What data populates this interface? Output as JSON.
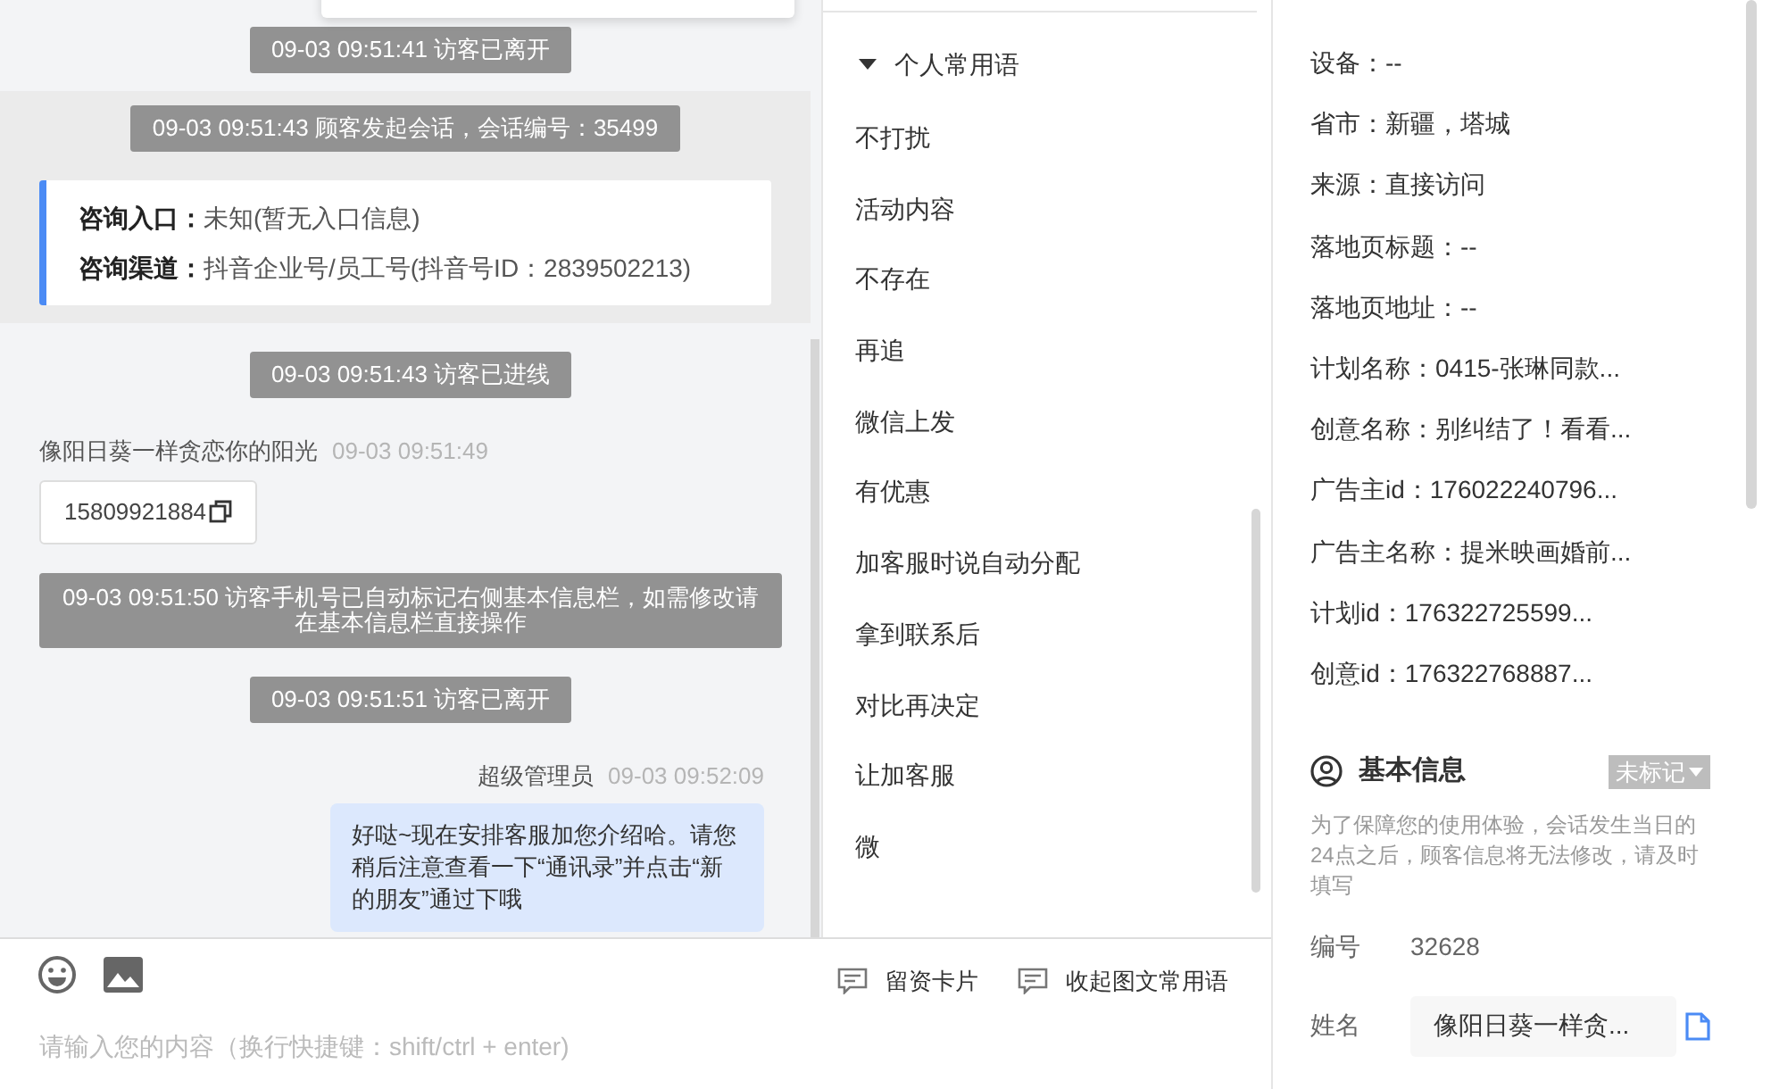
{
  "chat": {
    "messages": [
      {
        "kind": "system",
        "text": "09-03 09:51:41 访客已离开"
      },
      {
        "kind": "session",
        "notice": "09-03 09:51:43 顾客发起会话，会话编号：35499",
        "entry": [
          {
            "label": "咨询入口：",
            "value": "未知(暂无入口信息)"
          },
          {
            "label": "咨询渠道：",
            "value": "抖音企业号/员工号(抖音号ID：2839502213)"
          }
        ]
      },
      {
        "kind": "system",
        "text": "09-03 09:51:43 访客已进线"
      },
      {
        "kind": "visitor",
        "name": "像阳日葵一样贪恋你的阳光",
        "time": "09-03 09:51:49"
      },
      {
        "kind": "phone",
        "text": "15809921884"
      },
      {
        "kind": "system",
        "text": "09-03 09:51:50 访客手机号已自动标记右侧基本信息栏，如需修改请在基本信息栏直接操作"
      },
      {
        "kind": "system",
        "text": "09-03 09:51:51 访客已离开"
      },
      {
        "kind": "agent",
        "name": "超级管理员",
        "time": "09-03 09:52:09",
        "text": "好哒~现在安排客服加您介绍哈。请您稍后注意查看一下“通讯录”并点击“新的朋友”通过下哦"
      }
    ]
  },
  "phrases": {
    "title": "个人常用语",
    "expanded": true,
    "items": [
      "不打扰",
      "活动内容",
      "不存在",
      "再追",
      "微信上发",
      "有优惠",
      "加客服时说自动分配",
      "拿到联系后",
      "对比再决定",
      "让加客服",
      "微"
    ]
  },
  "composer": {
    "placeholder": "请输入您的内容（换行快捷键：shift/ctrl + enter)",
    "actions": [
      "留资卡片",
      "收起图文常用语"
    ]
  },
  "source_info": {
    "fields": [
      "设备：--",
      "省市：新疆，塔城",
      "来源：直接访问",
      "落地页标题：--",
      "落地页地址：--",
      "计划名称：0415-张琳同款...",
      "创意名称：别纠结了！看看...",
      "广告主id：176022240796...",
      "广告主名称：提米映画婚前...",
      "计划id：176322725599...",
      "创意id：176322768887..."
    ]
  },
  "basic_info": {
    "title": "基本信息",
    "tag": "未标记",
    "note": "为了保障您的使用体验，会话发生当日的24点之后，顾客信息将无法修改，请及时填写",
    "rows": [
      {
        "kind": "text",
        "label": "编号",
        "value": "32628"
      },
      {
        "kind": "field",
        "label": "姓名",
        "value": "像阳日葵一样贪..."
      }
    ]
  }
}
